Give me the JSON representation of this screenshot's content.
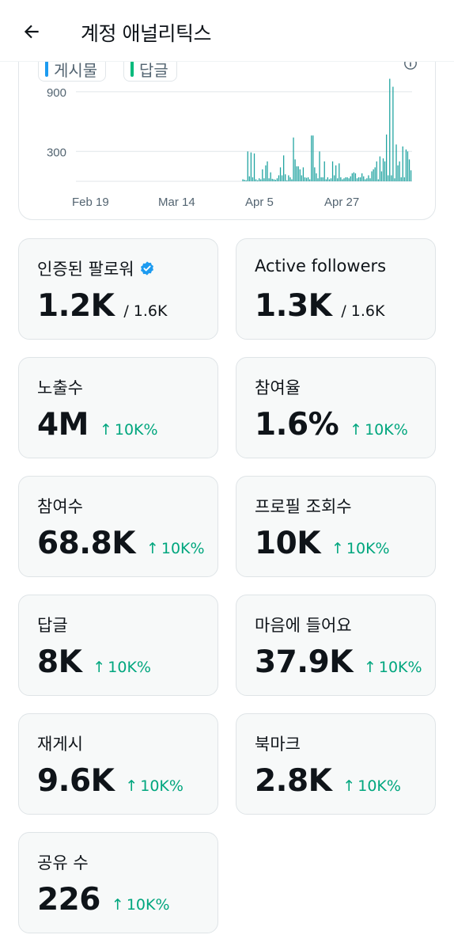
{
  "header": {
    "title": "계정 애널리틱스"
  },
  "chart": {
    "legend": [
      {
        "label": "게시물",
        "color": "#1d9bf0"
      },
      {
        "label": "답글",
        "color": "#00ba7c"
      }
    ],
    "yticks": [
      "900",
      "300"
    ],
    "xticks": [
      "Feb 19",
      "Mar 14",
      "Apr 5",
      "Apr 27"
    ],
    "bar_color": "#1fa3a0"
  },
  "chart_data": {
    "type": "bar",
    "x_labels": [
      "Feb 19",
      "Mar 14",
      "Apr 5",
      "Apr 27"
    ],
    "yticks": [
      300,
      900
    ],
    "ylim": [
      0,
      1050
    ],
    "values": [
      0,
      0,
      0,
      0,
      0,
      0,
      0,
      0,
      0,
      0,
      0,
      0,
      0,
      0,
      0,
      0,
      0,
      0,
      0,
      0,
      0,
      0,
      0,
      0,
      0,
      0,
      0,
      0,
      0,
      0,
      0,
      0,
      0,
      0,
      0,
      0,
      0,
      0,
      0,
      0,
      0,
      0,
      0,
      0,
      0,
      0,
      0,
      0,
      0,
      0,
      0,
      0,
      0,
      0,
      0,
      0,
      0,
      0,
      0,
      0,
      0,
      0,
      0,
      0,
      0,
      0,
      0,
      0,
      0,
      0,
      0,
      0,
      0,
      0,
      0,
      0,
      0,
      0,
      0,
      0,
      0,
      0,
      0,
      0,
      0,
      0,
      0,
      0,
      0,
      0,
      0,
      0,
      0,
      0,
      0,
      0,
      0,
      0,
      0,
      0,
      0,
      0,
      20,
      15,
      10,
      300,
      50,
      290,
      40,
      280,
      20,
      10,
      30,
      20,
      120,
      30,
      160,
      200,
      30,
      90,
      25,
      20,
      15,
      30,
      60,
      140,
      60,
      260,
      70,
      10,
      60,
      40,
      20,
      440,
      220,
      150,
      150,
      120,
      60,
      140,
      40,
      35,
      40,
      20,
      460,
      460,
      140,
      80,
      30,
      300,
      40,
      40,
      200,
      20,
      40,
      20,
      30,
      200,
      60,
      160,
      30,
      180,
      40,
      20,
      30,
      40,
      40,
      30,
      50,
      80,
      90,
      80,
      30,
      40,
      40,
      80,
      50,
      20,
      30,
      60,
      30,
      100,
      120,
      140,
      200,
      20,
      250,
      100,
      230,
      200,
      470,
      60,
      1030,
      60,
      950,
      30,
      370,
      160,
      200,
      40,
      350,
      40,
      320,
      300,
      220,
      110
    ]
  },
  "cards": [
    {
      "label": "인증된 팔로워",
      "value": "1.2K",
      "sub": "/ 1.6K",
      "delta": "",
      "verified": true
    },
    {
      "label": "Active followers",
      "value": "1.3K",
      "sub": "/ 1.6K",
      "delta": "",
      "verified": false
    },
    {
      "label": "노출수",
      "value": "4M",
      "sub": "",
      "delta": "10K%",
      "verified": false
    },
    {
      "label": "참여율",
      "value": "1.6%",
      "sub": "",
      "delta": "10K%",
      "verified": false
    },
    {
      "label": "참여수",
      "value": "68.8K",
      "sub": "",
      "delta": "10K%",
      "verified": false
    },
    {
      "label": "프로필 조회수",
      "value": "10K",
      "sub": "",
      "delta": "10K%",
      "verified": false
    },
    {
      "label": "답글",
      "value": "8K",
      "sub": "",
      "delta": "10K%",
      "verified": false
    },
    {
      "label": "마음에 들어요",
      "value": "37.9K",
      "sub": "",
      "delta": "10K%",
      "verified": false
    },
    {
      "label": "재게시",
      "value": "9.6K",
      "sub": "",
      "delta": "10K%",
      "verified": false
    },
    {
      "label": "북마크",
      "value": "2.8K",
      "sub": "",
      "delta": "10K%",
      "verified": false
    },
    {
      "label": "공유 수",
      "value": "226",
      "sub": "",
      "delta": "10K%",
      "verified": false
    }
  ],
  "icons": {
    "back": "arrow-left-icon",
    "info": "info-icon",
    "verified": "verified-badge-icon",
    "delta": "arrow-up-icon"
  }
}
